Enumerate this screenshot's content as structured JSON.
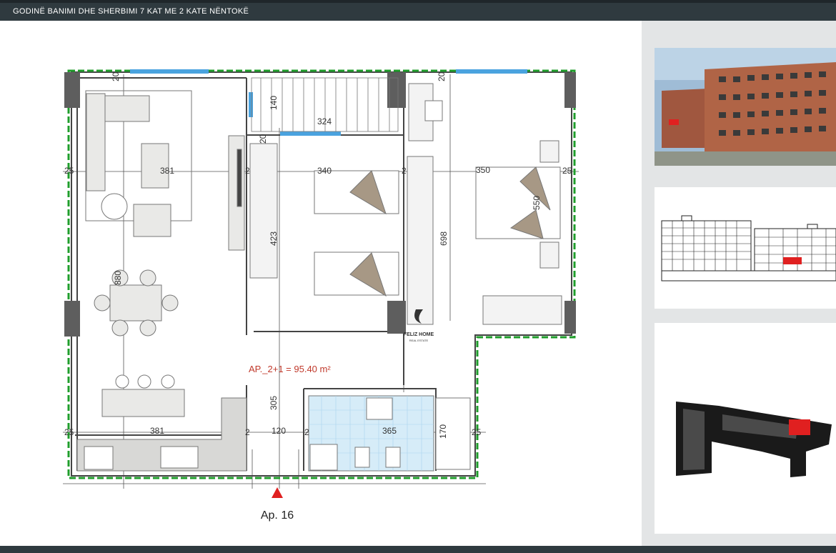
{
  "header": {
    "title": "GODINË BANIMI DHE SHERBIMI 7 KAT ME 2 KATE NËNTOKË"
  },
  "floorplan": {
    "area_label": "AP._2+1 = 95.40 m²",
    "apartment_label": "Ap. 16",
    "logo_name": "FELIZ HOME",
    "logo_sub": "REAL ESTATE",
    "dimensions": {
      "d_381_top": "381",
      "d_340": "340",
      "d_350": "350",
      "d_324": "324",
      "d_140": "140",
      "d_423": "423",
      "d_698": "698",
      "d_550": "550",
      "d_880": "880",
      "d_305": "305",
      "d_381_bottom": "381",
      "d_120": "120",
      "d_365": "365",
      "d_170": "170",
      "d_25": "25",
      "d_20": "20",
      "d_2": "2"
    },
    "colors": {
      "wall_outline": "#555555",
      "green_boundary": "#1f9d2b",
      "area_text": "#c0392b",
      "marker": "#e02020",
      "bath_tile": "#a9d4ee",
      "window": "#4aa3df"
    }
  },
  "side_panel": {
    "thumbnails": [
      "building-render",
      "building-elevation",
      "site-plan"
    ]
  }
}
